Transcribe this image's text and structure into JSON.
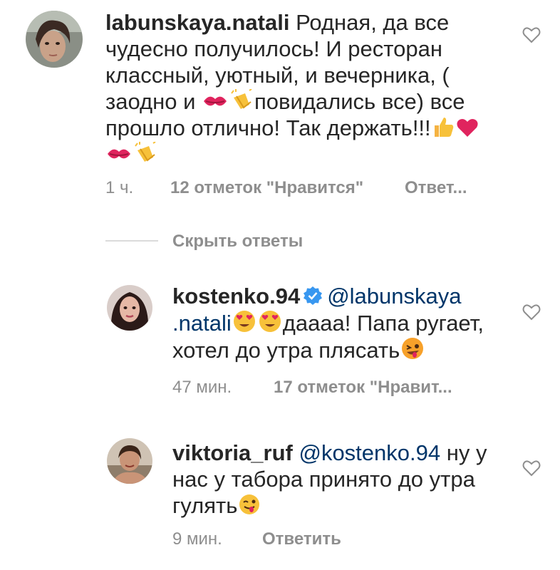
{
  "comments": [
    {
      "username": "labunskaya.natali",
      "text_parts": [
        "Родная, да все чудесно получилось! И ресторан классный, уютный, и вечерника, ( заодно и ",
        "повидались все) все прошло отлично! Так держать!!!"
      ],
      "time": "1 ч.",
      "likes": "12 отметок \"Нравится\"",
      "reply": "Ответ..."
    },
    {
      "username": "kostenko.94",
      "verified": true,
      "mention": "@labunskaya .natali",
      "text": "дaaaa! Папа ругает, хотел до утра плясать",
      "time": "47 мин.",
      "likes": "17 отметок \"Нравит..."
    },
    {
      "username": "viktoria_ruf",
      "mention": "@kostenko.94",
      "text": "ну у нас у табора принято до утра гулять",
      "time": "9 мин.",
      "reply": "Ответить"
    }
  ],
  "hide_replies": "Скрыть ответы",
  "colors": {
    "text": "#262626",
    "meta": "#8e8e8e",
    "mention": "#003569",
    "verified": "#3897f0"
  },
  "icons": [
    "heart-outline-icon",
    "verified-badge-icon",
    "kiss-emoji",
    "clapping-hands-emoji",
    "thumbs-up-emoji",
    "red-heart-emoji",
    "heart-eyes-emoji",
    "zany-face-emoji",
    "winking-tongue-emoji"
  ]
}
